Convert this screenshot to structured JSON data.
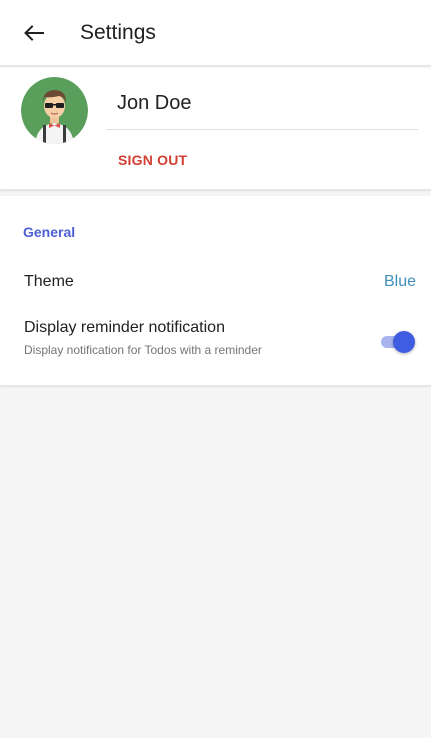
{
  "toolbar": {
    "title": "Settings",
    "back_icon": "arrow-left-icon"
  },
  "account": {
    "name": "Jon Doe",
    "sign_out_label": "SIGN OUT",
    "avatar_icon": "user-avatar-icon"
  },
  "general": {
    "header": "General",
    "theme": {
      "label": "Theme",
      "value": "Blue"
    },
    "reminder": {
      "title": "Display reminder notification",
      "subtitle": "Display notification for Todos with a reminder",
      "enabled": true
    }
  },
  "colors": {
    "accent": "#4e5fd6",
    "sign_out": "#d23f31",
    "theme_value": "#3f8fb8",
    "toggle_on": "#3f5de0"
  }
}
